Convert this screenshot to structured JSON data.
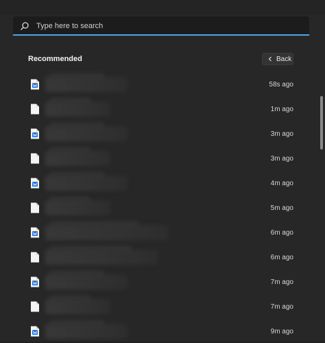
{
  "search": {
    "placeholder": "Type here to search"
  },
  "recommended": {
    "title": "Recommended",
    "back_label": "Back",
    "items": [
      {
        "icon": "word-doc-icon",
        "time": "58s ago",
        "w1": 120,
        "w2": 80
      },
      {
        "icon": "file-icon",
        "time": "1m ago",
        "w1": 95,
        "w2": 60
      },
      {
        "icon": "word-doc-icon",
        "time": "3m ago",
        "w1": 120,
        "w2": 80
      },
      {
        "icon": "file-icon",
        "time": "3m ago",
        "w1": 95,
        "w2": 60
      },
      {
        "icon": "word-doc-icon",
        "time": "4m ago",
        "w1": 120,
        "w2": 80
      },
      {
        "icon": "file-icon",
        "time": "5m ago",
        "w1": 95,
        "w2": 60
      },
      {
        "icon": "word-doc-icon",
        "time": "6m ago",
        "w1": 180,
        "w2": 130
      },
      {
        "icon": "file-icon",
        "time": "6m ago",
        "w1": 165,
        "w2": 120
      },
      {
        "icon": "word-doc-icon",
        "time": "7m ago",
        "w1": 120,
        "w2": 80
      },
      {
        "icon": "file-icon",
        "time": "7m ago",
        "w1": 95,
        "w2": 60
      },
      {
        "icon": "word-doc-icon",
        "time": "9m ago",
        "w1": 120,
        "w2": 80
      }
    ]
  }
}
